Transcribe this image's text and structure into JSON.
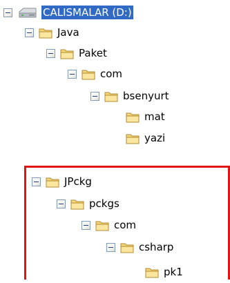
{
  "tree": {
    "nodes": [
      {
        "label": "CALISMALAR (D:)",
        "icon": "drive-icon",
        "expanded": true,
        "selected": true
      },
      {
        "label": "Java",
        "icon": "folder-icon",
        "expanded": true
      },
      {
        "label": "Paket",
        "icon": "folder-icon",
        "expanded": true
      },
      {
        "label": "com",
        "icon": "folder-icon",
        "expanded": true
      },
      {
        "label": "bsenyurt",
        "icon": "folder-icon",
        "expanded": true
      },
      {
        "label": "mat",
        "icon": "folder-icon",
        "leaf": true
      },
      {
        "label": "yazi",
        "icon": "folder-icon",
        "leaf": true
      },
      {
        "label": "JPckg",
        "icon": "folder-icon",
        "expanded": true
      },
      {
        "label": "pckgs",
        "icon": "folder-icon",
        "expanded": true
      },
      {
        "label": "com",
        "icon": "folder-icon",
        "expanded": true
      },
      {
        "label": "csharp",
        "icon": "folder-icon",
        "expanded": true
      },
      {
        "label": "pk1",
        "icon": "folder-icon",
        "leaf": true
      }
    ]
  },
  "colors": {
    "selection": "#316ac5",
    "highlight_border": "#e11414",
    "folder_fill": "#f6d77a",
    "expander_border": "#7f9db9"
  }
}
